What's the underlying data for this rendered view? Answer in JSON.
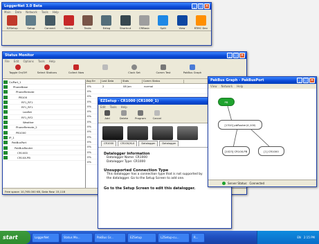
{
  "loggernet": {
    "title": "LoggerNet 3.0 Beta",
    "menu": [
      "Main",
      "Data",
      "Network",
      "Tools",
      "Help"
    ],
    "toolbar": [
      {
        "label": "EZSetup",
        "icon": "ez-setup-icon",
        "color": "#c0392b"
      },
      {
        "label": "Setup",
        "icon": "setup-icon",
        "color": "#607d8b"
      },
      {
        "label": "Connect",
        "icon": "connect-icon",
        "color": "#455a64"
      },
      {
        "label": "Status",
        "icon": "status-icon",
        "color": "#c62828"
      },
      {
        "label": "Tasks",
        "icon": "tasks-icon",
        "color": "#795548"
      },
      {
        "label": "Edlog",
        "icon": "edlog-icon",
        "color": "#546e7a"
      },
      {
        "label": "Shortcut",
        "icon": "shortcut-icon",
        "color": "#37474f"
      },
      {
        "label": "CRBasic",
        "icon": "crbasic-icon",
        "color": "#9e9e9e"
      },
      {
        "label": "Split",
        "icon": "split-icon",
        "color": "#1e88e5"
      },
      {
        "label": "View",
        "icon": "view-icon",
        "color": "#0d47a1"
      },
      {
        "label": "RTMC Dev",
        "icon": "rtmc-icon",
        "color": "#ff8f00"
      }
    ]
  },
  "status_monitor": {
    "title": "Status Monitor",
    "menu": [
      "File",
      "Edit",
      "Options",
      "Tools",
      "Help"
    ],
    "toolbar": [
      "Toggle On/Off",
      "Select Stations",
      "Collect Now",
      "",
      "Clock Set",
      "Comm Test",
      "PakBus Graph"
    ],
    "columns": [
      "Station Name",
      "",
      "Avg Err",
      "Last Data",
      "Stats",
      "Comm Status"
    ],
    "tree": [
      "CsiPort_1",
      "PhoneBase",
      "PhoneRemote",
      "PB100",
      "RF1_RF1",
      "RF1_RF1",
      "Leaflet",
      "RF1_RF2",
      "Weather",
      "PhoneRemote_2",
      "PB1000",
      "IP_1",
      "PakBusPort",
      "PakBusRouter",
      "CR1000",
      "CR10X-PB"
    ],
    "rows": [
      [
        "0%",
        "2",
        "08 Jan",
        "normal"
      ],
      [
        "0%",
        "",
        "",
        ""
      ],
      [
        "0%",
        "",
        "",
        ""
      ],
      [
        "0%",
        "",
        "",
        ""
      ],
      [
        "0%",
        "",
        "",
        ""
      ],
      [
        "0%",
        "",
        "",
        ""
      ],
      [
        "0%",
        "",
        "",
        ""
      ],
      [
        "0%",
        "",
        "",
        ""
      ],
      [
        "0%",
        "",
        "",
        ""
      ],
      [
        "0%",
        "",
        "",
        ""
      ],
      [
        "0%",
        "",
        "",
        ""
      ],
      [
        "0%",
        "",
        "",
        ""
      ],
      [
        "0%",
        "",
        "",
        ""
      ],
      [
        "0%",
        "",
        "",
        ""
      ],
      [
        "0%",
        "",
        "",
        ""
      ],
      [
        "0%",
        "",
        "",
        ""
      ]
    ],
    "status_text": "Free space: 10,765.000 KB, Data flow: 15,118"
  },
  "ezsetup": {
    "title": "EZSetup - CR1000 (CR1000_1)",
    "menu": [
      "Edit",
      "Tools",
      "Help"
    ],
    "toolbar": [
      "Add",
      "Delete",
      "Program",
      "Cancel"
    ],
    "tabs": [
      "CR1000",
      "CR10X/XLX",
      "Datalogger",
      "Datalogger"
    ],
    "register_header": "Datalogger Information",
    "register_name": "Datalogger Name: CR1000",
    "register_type": "Datalogger Type: CR1000",
    "conn_header": "Unsupported Connection Type",
    "conn_line1": "This datalogger has a connection type that is not supported by",
    "conn_line2": "the datalogger. Go to the Setup Screen to add one.",
    "footer": "Go to the Setup Screen to edit this datalogger."
  },
  "pakbus_graph": {
    "title": "PakBus Graph - PakBusPort",
    "menu": [
      "View",
      "Network",
      "Help"
    ],
    "nodes": {
      "root": "PB",
      "mid": "[1310] pbRouter(4,100)",
      "left": "[1023] CR10X-PB",
      "right": "[1] CR1000"
    },
    "status_label": "Server Status:",
    "status_value": "Connected"
  },
  "taskbar": {
    "start": "start",
    "items": [
      "LoggerNet",
      "Status Mo...",
      "PakBus Gr...",
      "EZSetup",
      "LZSetup-cu...",
      "R..."
    ],
    "time": "2:15 PM",
    "lang": "EN"
  }
}
